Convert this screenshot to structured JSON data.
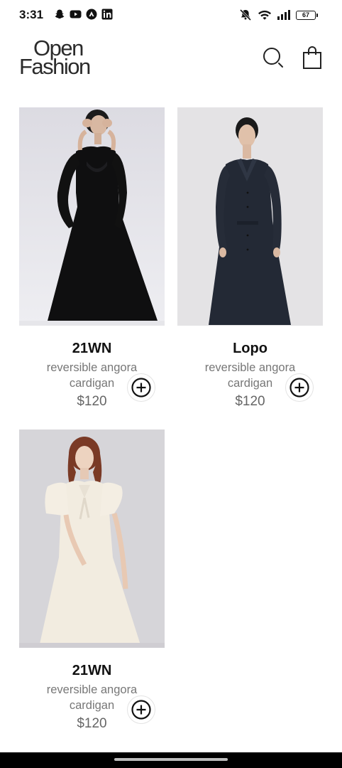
{
  "status_bar": {
    "time": "3:31",
    "battery_level": "67",
    "notification_icons": [
      "snapchat-icon",
      "youtube-icon",
      "app-icon",
      "linkedin-icon"
    ],
    "system_icons": [
      "mute-icon",
      "wifi-icon",
      "signal-icon",
      "battery-icon"
    ]
  },
  "header": {
    "logo_line1": "Open",
    "logo_line2": "Fashion",
    "search_icon": "search-icon",
    "bag_icon": "shopping-bag-icon"
  },
  "products": [
    {
      "brand": "21WN",
      "description": "reversible angora cardigan",
      "price": "$120",
      "image": "black-long-sleeve-dress"
    },
    {
      "brand": "Lopo",
      "description": "reversible angora cardigan",
      "price": "$120",
      "image": "navy-coat-dress"
    },
    {
      "brand": "21WN",
      "description": "reversible angora cardigan",
      "price": "$120",
      "image": "cream-short-sleeve-dress"
    }
  ],
  "colors": {
    "background": "#ffffff",
    "brand_text": "#111111",
    "desc_text": "#777777",
    "price_text": "#666666",
    "nav_bar": "#000000"
  }
}
